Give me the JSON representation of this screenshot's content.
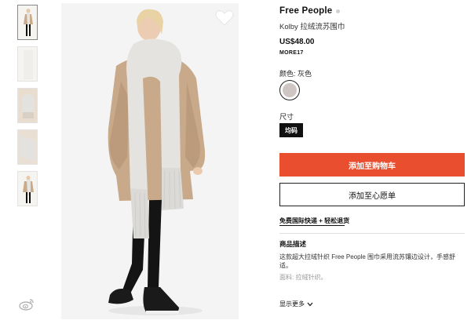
{
  "product": {
    "brand": "Free People",
    "name": "Kolby 拉绒流苏围巾",
    "price": "US$48.00",
    "promo_code": "MORE17"
  },
  "color": {
    "label": "颜色: 灰色",
    "selected_hex": "#cdc6c2"
  },
  "size": {
    "label": "尺寸",
    "selected": "均码"
  },
  "buttons": {
    "add_to_cart": "添加至购物车",
    "add_to_wishlist": "添加至心愿单"
  },
  "shipping": {
    "text": "免费国际快递 + 轻松退货"
  },
  "description": {
    "title": "商品描述",
    "body": "这款超大拉绒针织 Free People 围巾采用流苏镶边设计，手感舒适。",
    "fabric": "面料: 拉绒针织。",
    "more": "显示更多"
  },
  "colors": {
    "cart_button": "#e94e2e"
  },
  "icons": {
    "wishlist": "heart-icon",
    "social": "weibo-icon",
    "expand": "chevron-down-icon"
  }
}
